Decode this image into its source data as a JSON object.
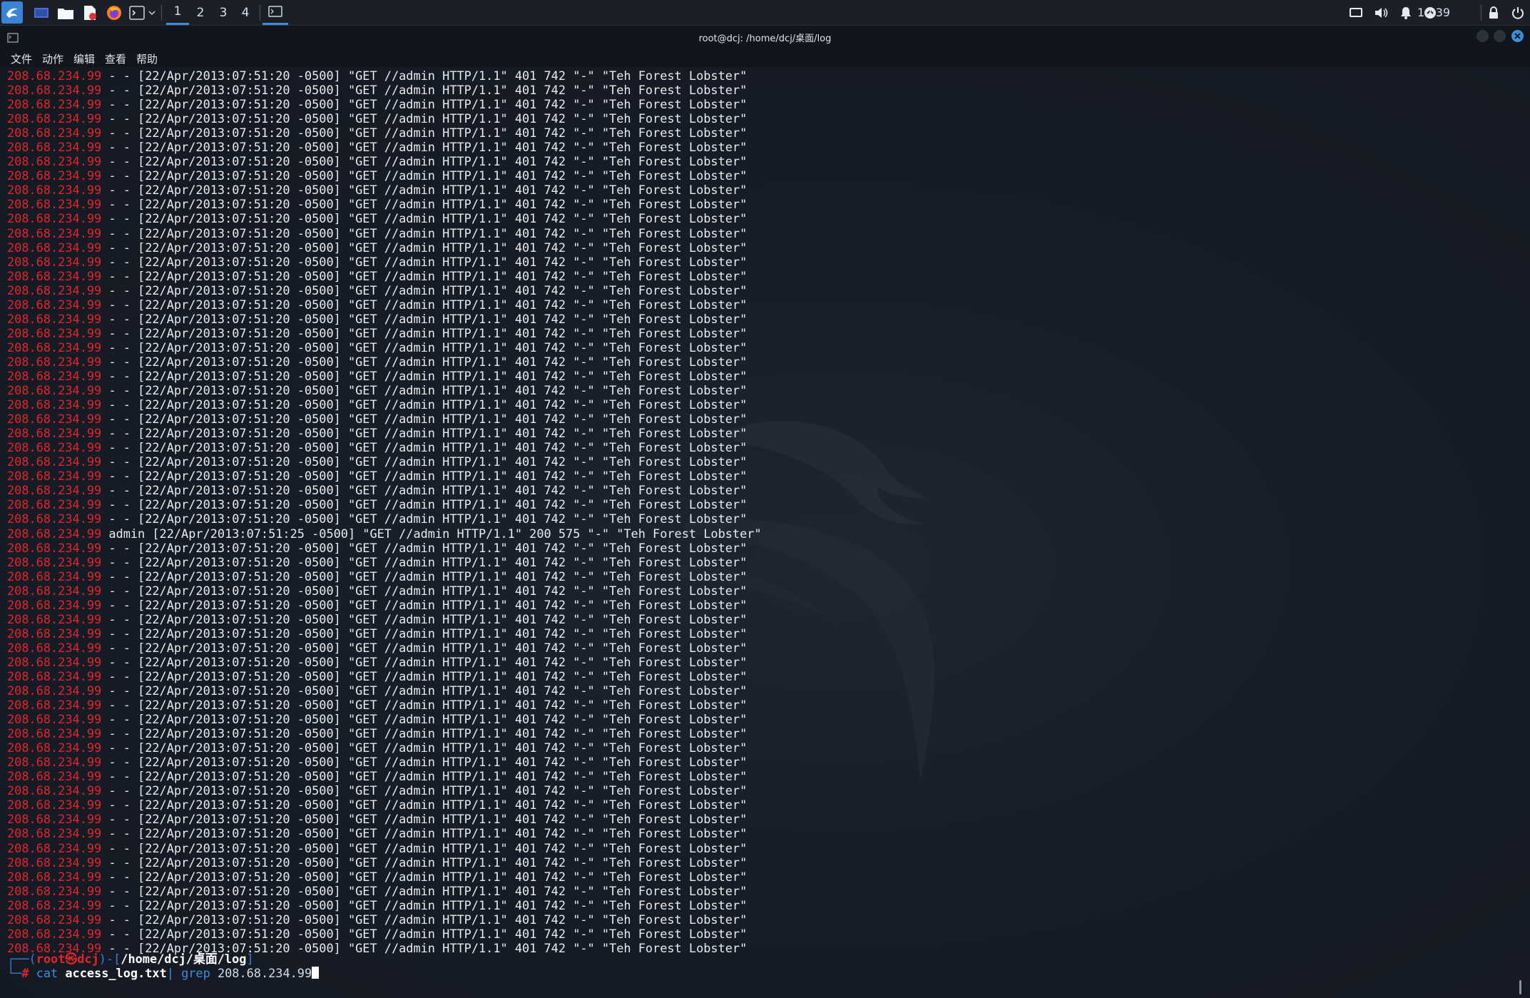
{
  "panel": {
    "workspaces": [
      "1",
      "2",
      "3",
      "4"
    ],
    "clock": "10:39",
    "icons": [
      "kali-menu-icon",
      "desktop-icon",
      "file-manager-icon",
      "text-editor-icon",
      "firefox-icon",
      "terminal-icon",
      "chevron-down-icon",
      "terminal-window-icon",
      "display-icon",
      "volume-icon",
      "bell-icon",
      "network-icon",
      "lock-icon",
      "power-icon"
    ]
  },
  "window": {
    "title": "root@dcj: /home/dcj/桌面/log",
    "menu": [
      "文件",
      "动作",
      "编辑",
      "查看",
      "帮助"
    ]
  },
  "log": {
    "ip": "208.68.234.99",
    "line_401": " - - [22/Apr/2013:07:51:20 -0500] \"GET //admin HTTP/1.1\" 401 742 \"-\" \"Teh Forest Lobster\"",
    "line_200": " admin [22/Apr/2013:07:51:25 -0500] \"GET //admin HTTP/1.1\" 200 575 \"-\" \"Teh Forest Lobster\"",
    "rows_before": 32,
    "rows_after": 29
  },
  "prompt": {
    "user": "root㉿dcj",
    "path": "/home/dcj/桌面/log",
    "command": "cat",
    "arg": "access_log.txt",
    "pipe": "|",
    "cmd2": "grep",
    "arg2": "208.68.234.99"
  },
  "colors": {
    "ip": "#e2252c",
    "text": "#e8ebf0",
    "background": "#161b24",
    "accent": "#3e8ddd"
  }
}
